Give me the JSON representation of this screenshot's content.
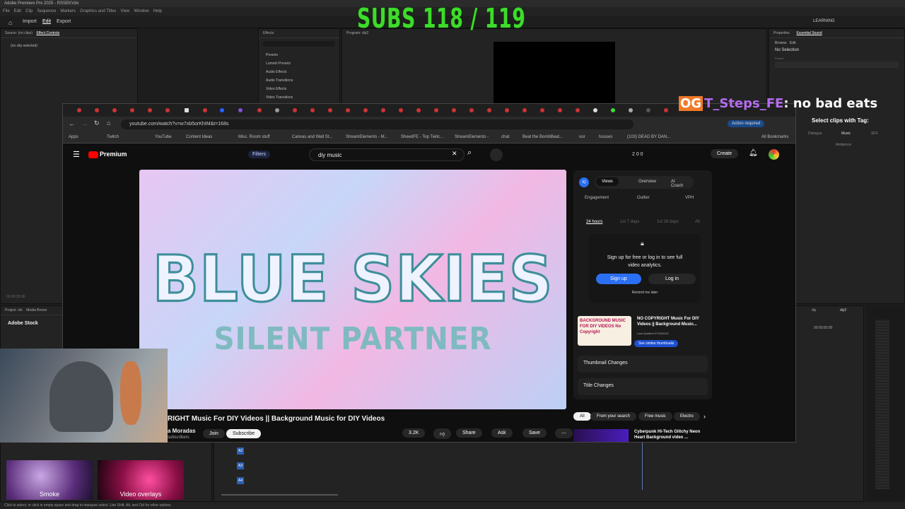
{
  "premiere": {
    "title": "Adobe Premiere Pro 2025 - RSSEKVdx",
    "menu": [
      "File",
      "Edit",
      "Clip",
      "Sequence",
      "Markers",
      "Graphics and Titles",
      "View",
      "Window",
      "Help"
    ],
    "tabs": [
      "Import",
      "Edit",
      "Export"
    ],
    "learning": "LEARNING",
    "source_tabs": [
      "Source: (no clips)",
      "Effect Controls"
    ],
    "no_clip": "(no clip selected)",
    "effects_title": "Effects",
    "effects": [
      "Presets",
      "Lumetri Presets",
      "Audio Effects",
      "Audio Transitions",
      "Video Effects",
      "Video Transitions"
    ],
    "program": "Program: diy2",
    "props": [
      "Properties",
      "Essential Sound"
    ],
    "browse": [
      "Browse",
      "Edit"
    ],
    "no_selection": "No Selection",
    "preset": "Preset:",
    "select_clips": "Select clips with Tag:",
    "tags": [
      "Dialogue",
      "Music",
      "SFX",
      "Ambience"
    ],
    "project": "Project: sfx",
    "media_browser": "Media Brows",
    "adobe_stock": "Adobe Stock",
    "timecode": "00:00:33:06",
    "seq_tabs": [
      "diy",
      "diy2"
    ],
    "seq_time": "00:00:50:00",
    "tracks": [
      "A2",
      "A3",
      "A4"
    ],
    "thumbs": [
      "Smoke",
      "Video overlays"
    ],
    "status": "Click to select, or click in empty space and drag to marquee select. Use Shift, Alt, and Ctrl for other options."
  },
  "overlay": {
    "subs": "SUBS 118 / 119",
    "og": "OG",
    "steps": "T_Steps_FE",
    "msg": ": no bad eats"
  },
  "browser": {
    "url": "youtube.com/watch?v=w7xb5orKhIM&t=168s",
    "action": "Action required",
    "bookmarks": [
      "Apps",
      "Twitch",
      "YouTube",
      "Content Ideas",
      "Misc. Room stuff",
      "Canvas and Wall St...",
      "StreamElements - M...",
      "SheedFE - Top Twitc...",
      "StreamElements -",
      "chat",
      "Beat the BombBeat...",
      "oor",
      "houses",
      "(103) DEAD BY DAN..."
    ],
    "all_bookmarks": "All Bookmarks"
  },
  "youtube": {
    "logo": "Premium",
    "filters": "Filters",
    "search": "diy music",
    "create": "Create",
    "counters": "2  0  0",
    "video_title": "RIGHT Music For DIY Videos || Background Music for DIY Videos",
    "channel": "a Moradas",
    "subscribers": "subscribers",
    "join": "Join",
    "subscribe": "Subscribe",
    "likes": "3.2K",
    "share": "Share",
    "ask": "Ask",
    "save": "Save",
    "chips": [
      "All",
      "From your search",
      "Free music",
      "Electro"
    ]
  },
  "thumbnail": {
    "line1": "BLUE SKIES",
    "line2": "SILENT PARTNER"
  },
  "vidiq": {
    "badge": "IQ",
    "tabs": [
      "Views",
      "Overview",
      "AI Coach"
    ],
    "stats": [
      "Engagement",
      "Outlier",
      "VPH"
    ],
    "ranges": [
      "24 hours",
      "1st 7 days",
      "1st 28 days",
      "All"
    ],
    "prompt": "Sign up for free or log in to see full video analytics.",
    "signup": "Sign up",
    "login": "Log in",
    "remind": "Remind me later",
    "rel_title": "NO COPYRIGHT Music For DIY Videos || Background Music...",
    "rel_date": "Last Updated 07/04/2021",
    "similar": "See similar thumbnails",
    "thumb_changes": "Thumbnail Changes",
    "title_changes": "Title Changes",
    "thumb_text": "BACKGROUND MUSIC FOR DIY VIDEOS No Copyright"
  },
  "next_video": {
    "title": "Cyberpunk Hi-Tech Glitchy Neon Heart Background video ..."
  }
}
